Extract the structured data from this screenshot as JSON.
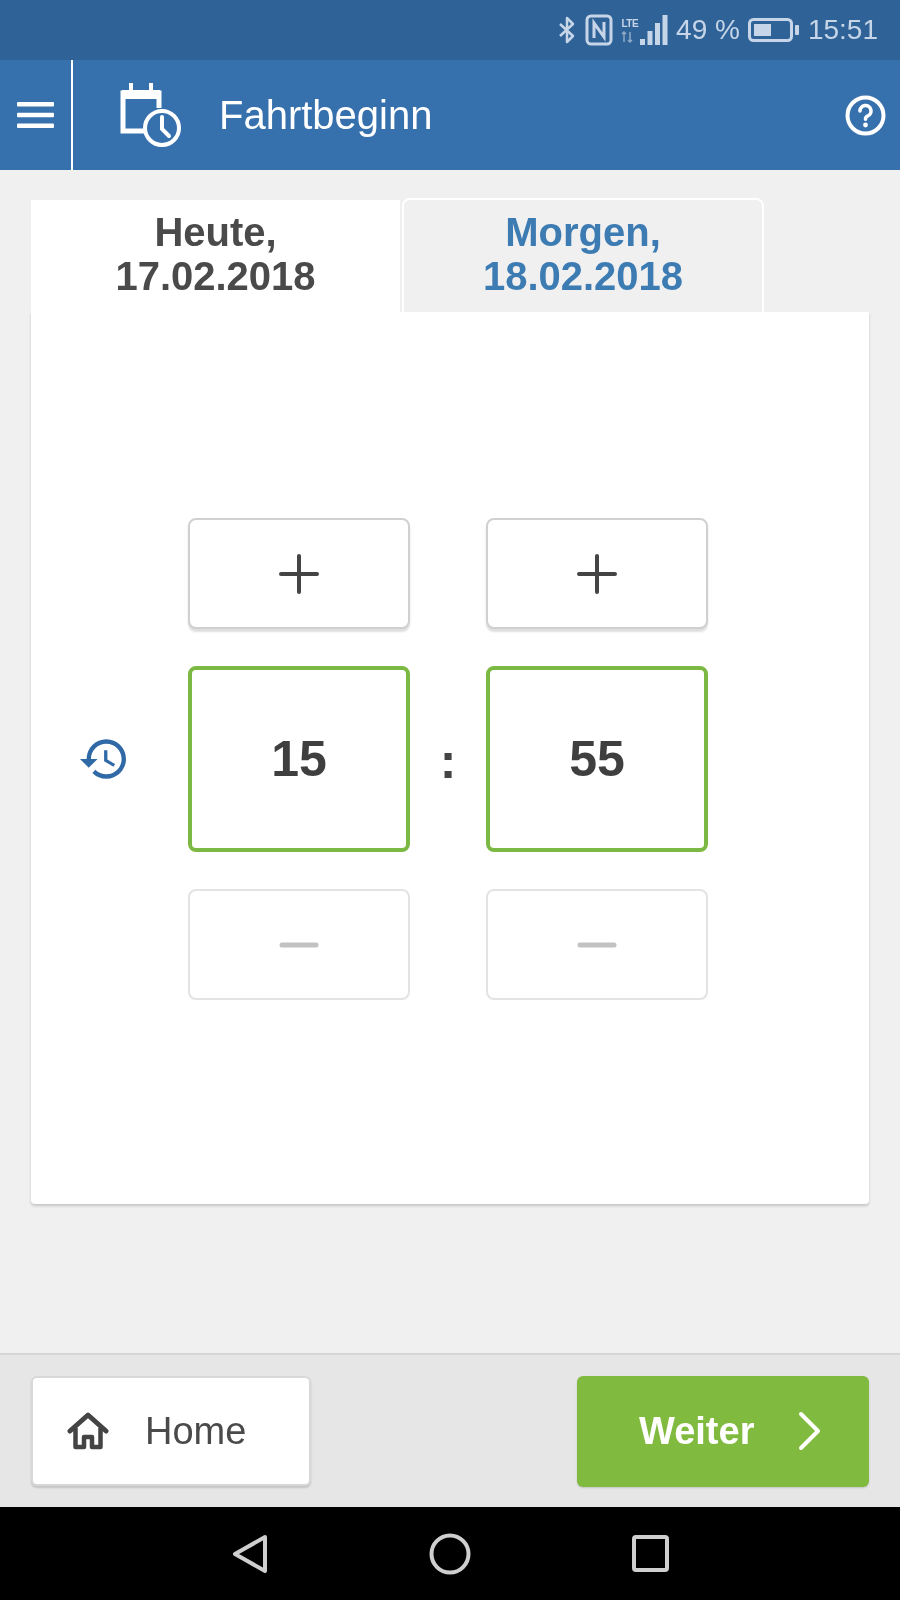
{
  "status_bar": {
    "network": "LTE",
    "battery": "49 %",
    "time": "15:51"
  },
  "header": {
    "title": "Fahrtbeginn"
  },
  "tabs": [
    {
      "label": "Heute,",
      "date": "17.02.2018",
      "selected": true
    },
    {
      "label": "Morgen,",
      "date": "18.02.2018",
      "selected": false
    }
  ],
  "time_picker": {
    "separator": ":",
    "columns": [
      {
        "increment": {
          "disabled": false
        },
        "value": "15",
        "decrement": {
          "disabled": true
        }
      },
      {
        "increment": {
          "disabled": false
        },
        "value": "55",
        "decrement": {
          "disabled": true
        }
      }
    ]
  },
  "footer": {
    "home_button": {
      "label": "Home"
    },
    "next_button": {
      "label": "Weiter"
    }
  }
}
